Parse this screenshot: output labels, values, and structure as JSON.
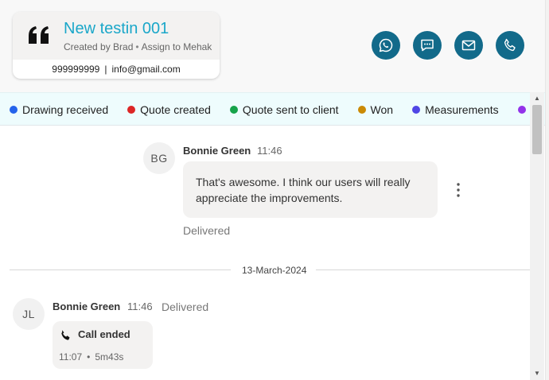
{
  "lead": {
    "title": "New testin 001",
    "created_by": "Created by Brad",
    "assigned_to": "Assign to Mehak",
    "phone": "999999999",
    "email": "info@gmail.com",
    "separator": "|"
  },
  "actions": [
    {
      "name": "whatsapp-button",
      "icon": "whatsapp-icon"
    },
    {
      "name": "sms-button",
      "icon": "message-icon"
    },
    {
      "name": "email-button",
      "icon": "mail-icon"
    },
    {
      "name": "call-button",
      "icon": "phone-icon"
    }
  ],
  "statuses": [
    {
      "label": "Drawing received",
      "color": "#2563eb"
    },
    {
      "label": "Quote created",
      "color": "#dc2626"
    },
    {
      "label": "Quote sent to client",
      "color": "#16a34a"
    },
    {
      "label": "Won",
      "color": "#ca8a04"
    },
    {
      "label": "Measurements",
      "color": "#4f46e5"
    },
    {
      "label": "",
      "color": "#9333ea"
    }
  ],
  "messages": {
    "first": {
      "initials": "BG",
      "sender": "Bonnie Green",
      "time": "11:46",
      "text": "That's awesome. I think our users will really appreciate the improvements.",
      "status": "Delivered"
    },
    "date_divider": "13-March-2024",
    "second": {
      "initials": "JL",
      "sender": "Bonnie Green",
      "time": "11:46",
      "status": "Delivered",
      "call_title": "Call ended",
      "call_time": "11:07",
      "call_duration": "5m43s"
    }
  },
  "colors": {
    "accent_title": "#1aa7c9",
    "action_button": "#126a8a",
    "status_bar_bg": "#eefcfd"
  }
}
